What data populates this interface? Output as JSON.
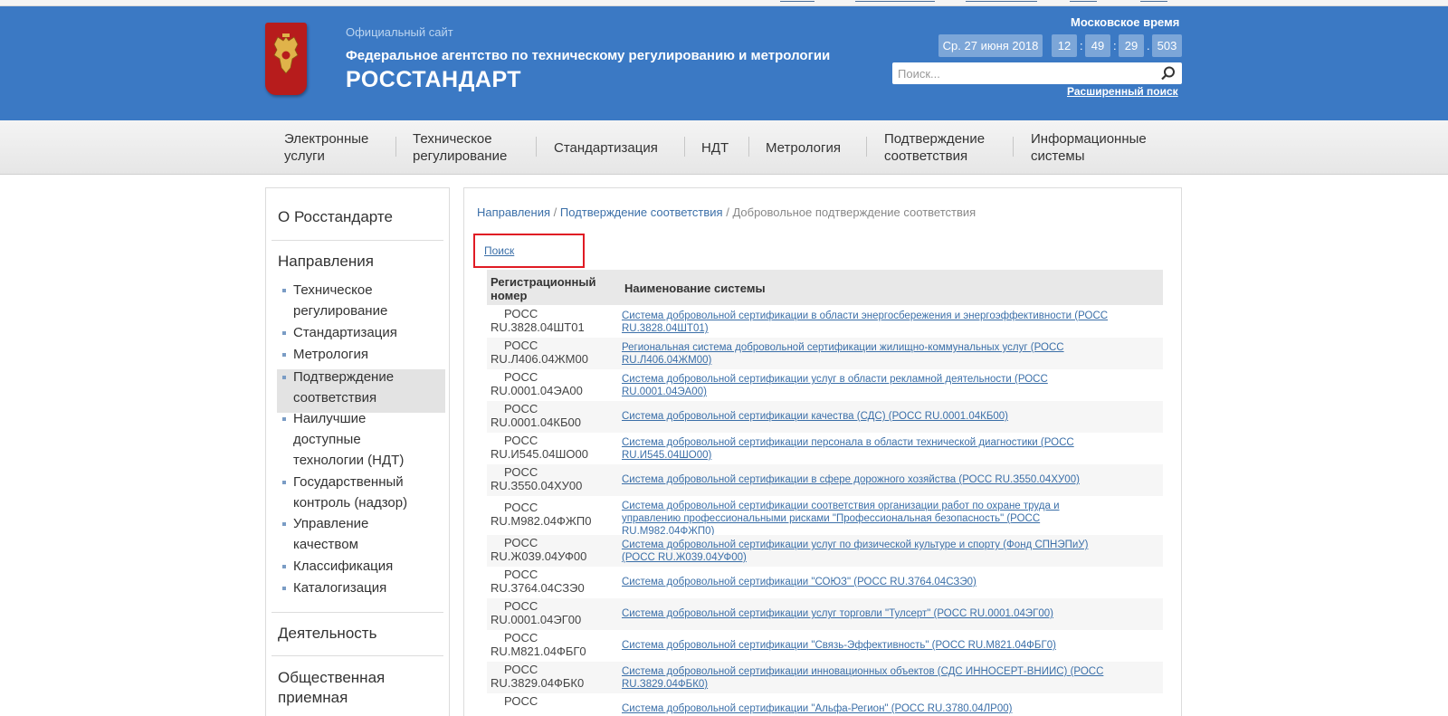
{
  "header": {
    "official": "Официальный сайт",
    "agency": "Федеральное агентство по техническому регулированию и метрологии",
    "brand": "РОССТАНДАРТ",
    "moscow_time_label": "Московское время",
    "date": "Ср. 27 июня 2018",
    "hours": "12",
    "minutes": "49",
    "seconds": "29",
    "ms": "503",
    "search_placeholder": "Поиск...",
    "advanced_search": "Расширенный поиск"
  },
  "nav": [
    {
      "line1": "Электронные",
      "line2": "услуги"
    },
    {
      "line1": "Техническое",
      "line2": "регулирование"
    },
    {
      "line1": "Стандартизация",
      "line2": ""
    },
    {
      "line1": "НДТ",
      "line2": ""
    },
    {
      "line1": "Метрология",
      "line2": ""
    },
    {
      "line1": "Подтверждение",
      "line2": "соответствия"
    },
    {
      "line1": "Информационные",
      "line2": "системы"
    }
  ],
  "sidebar": {
    "about": "О Росстандарте",
    "directions": "Направления",
    "items": [
      {
        "line1": "Техническое",
        "line2": "регулирование"
      },
      {
        "line1": "Стандартизация",
        "line2": ""
      },
      {
        "line1": "Метрология",
        "line2": ""
      },
      {
        "line1": "Подтверждение",
        "line2": "соответствия"
      },
      {
        "line1": "Наилучшие",
        "line2": "доступные",
        "line3": "технологии (НДТ)"
      },
      {
        "line1": "Государственный",
        "line2": "контроль (надзор)"
      },
      {
        "line1": "Управление",
        "line2": "качеством"
      },
      {
        "line1": "Классификация",
        "line2": ""
      },
      {
        "line1": "Каталогизация",
        "line2": ""
      }
    ],
    "activity": "Деятельность",
    "reception_1": "Общественная",
    "reception_2": "приемная"
  },
  "breadcrumb": {
    "directions": "Направления",
    "confirmation": "Подтверждение соответствия",
    "sep": "/",
    "current": "Добровольное подтверждение соответствия"
  },
  "search_link": "Поиск",
  "table": {
    "col_reg_1": "Регистрационный",
    "col_reg_2": "номер",
    "col_name": "Наименование системы",
    "rows": [
      {
        "reg1": "РОСС",
        "reg2": "RU.3828.04ШТ01",
        "name": [
          "Система добровольной сертификации в области энергосбережения и энергоэффективности (РОСС",
          "RU.3828.04ШТ01)"
        ]
      },
      {
        "reg1": "РОСС",
        "reg2": "RU.Л406.04ЖМ00",
        "name": [
          "Региональная система добровольной сертификации жилищно-коммунальных услуг (РОСС",
          "RU.Л406.04ЖМ00)"
        ]
      },
      {
        "reg1": "РОСС",
        "reg2": "RU.0001.04ЭА00",
        "name": [
          "Система добровольной сертификации услуг в области рекламной деятельности (РОСС",
          "RU.0001.04ЭА00)"
        ]
      },
      {
        "reg1": "РОСС",
        "reg2": "RU.0001.04КБ00",
        "name": [
          "Система добровольной сертификации качества (СДС) (РОСС RU.0001.04КБ00)"
        ]
      },
      {
        "reg1": "РОСС",
        "reg2": "RU.И545.04ШО00",
        "name": [
          "Система добровольной сертификации персонала в области технической диагностики (РОСС",
          "RU.И545.04ШО00)"
        ]
      },
      {
        "reg1": "РОСС",
        "reg2": "RU.З550.04ХУ00",
        "name": [
          "Система добровольной сертификации в сфере дорожного хозяйства (РОСС RU.З550.04ХУ00)"
        ]
      },
      {
        "reg1": "РОСС",
        "reg2": "RU.M982.04ФЖП0",
        "name": [
          "Система добровольной сертификации соответствия организации работ по охране труда и",
          "управлению профессиональными рисками \"Профессиональная безопасность\" (РОСС",
          "RU.M982.04ФЖП0)"
        ]
      },
      {
        "reg1": "РОСС",
        "reg2": "RU.Ж039.04УФ00",
        "name": [
          "Система добровольной сертификации услуг по физической культуре и спорту (Фонд СПНЭПиУ)",
          "(РОСС RU.Ж039.04УФ00)"
        ]
      },
      {
        "reg1": "РОСС",
        "reg2": "RU.З764.04СЗЭ0",
        "name": [
          "Система добровольной сертификации \"СОЮЗ\" (РОСС RU.З764.04СЗЭ0)"
        ]
      },
      {
        "reg1": "РОСС",
        "reg2": "RU.0001.04ЭГ00",
        "name": [
          "Система добровольной сертификации услуг торговли \"Тулсерт\" (РОСС RU.0001.04ЭГ00)"
        ]
      },
      {
        "reg1": "РОСС",
        "reg2": "RU.M821.04ФБГ0",
        "name": [
          "Система добровольной сертификации \"Связь-Эффективность\" (РОСС RU.M821.04ФБГ0)"
        ]
      },
      {
        "reg1": "РОСС",
        "reg2": "RU.З829.04ФБК0",
        "name": [
          "Система добровольной сертификации инновационных объектов (СДС ИННОСЕРТ-ВНИИС) (РОСС",
          "RU.З829.04ФБК0)"
        ]
      },
      {
        "reg1": "РОСС",
        "reg2": "",
        "name": [
          "Система добровольной сертификации \"Альфа-Регион\" (РОСС RU.З780.04ЛР00)"
        ]
      }
    ]
  }
}
